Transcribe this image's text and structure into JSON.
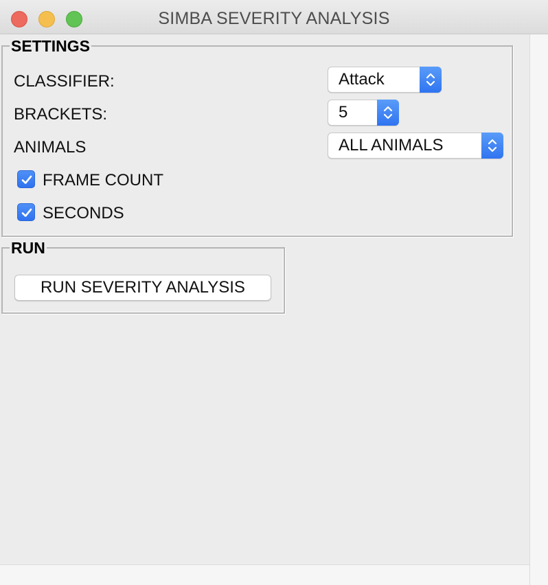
{
  "window": {
    "title": "SIMBA SEVERITY ANALYSIS",
    "controls": [
      "close",
      "minimize",
      "maximize"
    ]
  },
  "settings": {
    "legend": "SETTINGS",
    "classifier": {
      "label": "CLASSIFIER:",
      "value": "Attack"
    },
    "brackets": {
      "label": "BRACKETS:",
      "value": "5"
    },
    "animals": {
      "label": "ANIMALS",
      "value": "ALL ANIMALS"
    },
    "frame_count": {
      "label": "FRAME COUNT",
      "checked": true
    },
    "seconds": {
      "label": "SECONDS",
      "checked": true
    }
  },
  "run": {
    "legend": "RUN",
    "button_label": "RUN SEVERITY ANALYSIS"
  },
  "colors": {
    "accent": "#2f74f0",
    "close": "#ed6a5e",
    "minimize": "#f5bf4f",
    "maximize": "#61c454"
  }
}
